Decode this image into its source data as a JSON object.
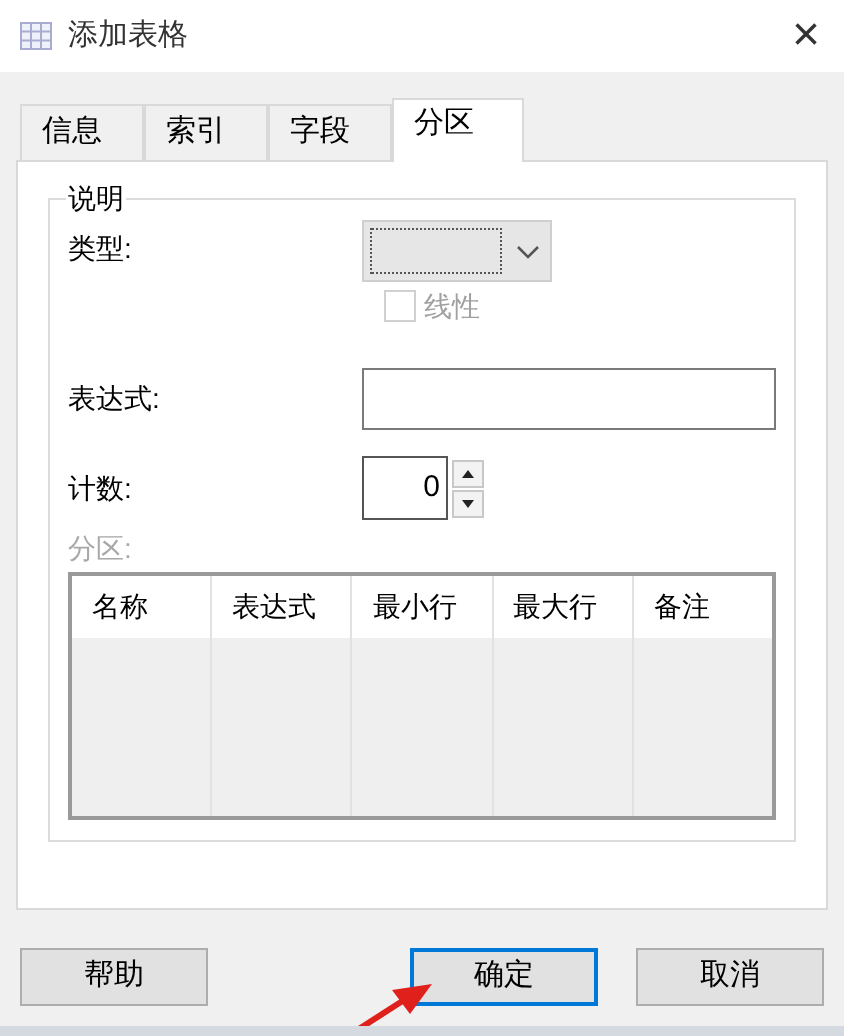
{
  "window": {
    "title": "添加表格",
    "close": "×"
  },
  "tabs": [
    {
      "label": "信息",
      "selected": false
    },
    {
      "label": "索引",
      "selected": false
    },
    {
      "label": "字段",
      "selected": false
    },
    {
      "label": "分区",
      "selected": true
    }
  ],
  "group": {
    "legend": "说明",
    "type": {
      "label": "类型:",
      "disabled": true
    },
    "linear": {
      "label": "线性",
      "checked": false,
      "disabled": true
    },
    "expression": {
      "label": "表达式:"
    },
    "count": {
      "label": "计数:",
      "value": "0"
    },
    "partitions": {
      "label": "分区:",
      "disabled": true,
      "columns": [
        "名称",
        "表达式",
        "最小行",
        "最大行",
        "备注"
      ]
    }
  },
  "buttons": [
    {
      "label": "帮助",
      "focused": false
    },
    {
      "label": "确定",
      "focused": true
    },
    {
      "label": "取消",
      "focused": false
    }
  ]
}
